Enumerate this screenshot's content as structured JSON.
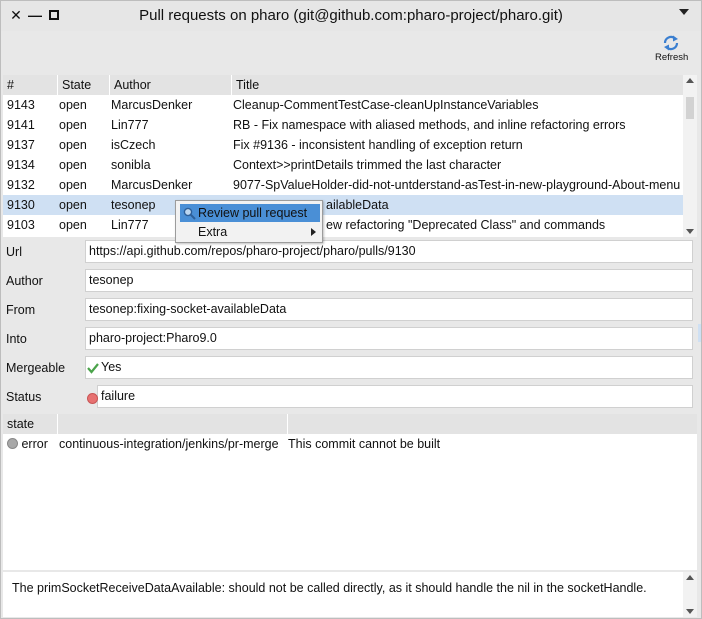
{
  "window": {
    "title": "Pull requests on pharo (git@github.com:pharo-project/pharo.git)"
  },
  "toolbar": {
    "refresh_label": "Refresh",
    "refresh_icon": "refresh-icon"
  },
  "pr_table": {
    "columns": [
      "#",
      "State",
      "Author",
      "Title"
    ],
    "rows": [
      {
        "num": "9143",
        "state": "open",
        "author": "MarcusDenker",
        "title": "Cleanup-CommentTestCase-cleanUpInstanceVariables"
      },
      {
        "num": "9141",
        "state": "open",
        "author": "Lin777",
        "title": "RB - Fix namespace with aliased methods, and inline refactoring errors"
      },
      {
        "num": "9137",
        "state": "open",
        "author": "isCzech",
        "title": "Fix #9136 - inconsistent handling of exception return"
      },
      {
        "num": "9134",
        "state": "open",
        "author": "sonibla",
        "title": "Context>>printDetails trimmed the last character"
      },
      {
        "num": "9132",
        "state": "open",
        "author": "MarcusDenker",
        "title": "9077-SpValueHolder-did-not-untderstand-asTest-in-new-playground-About-menu"
      },
      {
        "num": "9130",
        "state": "open",
        "author": "tesonep",
        "title": "ailableData"
      },
      {
        "num": "9103",
        "state": "open",
        "author": "Lin777",
        "title": "ew refactoring \"Deprecated Class\" and commands"
      }
    ],
    "selected_index": 5
  },
  "context_menu": {
    "items": [
      {
        "label": "Review pull request",
        "icon": "magnifier-icon"
      },
      {
        "label": "Extra",
        "submenu": true
      }
    ]
  },
  "details": {
    "url_label": "Url",
    "url_value": "https://api.github.com/repos/pharo-project/pharo/pulls/9130",
    "author_label": "Author",
    "author_value": "tesonep",
    "from_label": "From",
    "from_value": "tesonep:fixing-socket-availableData",
    "into_label": "Into",
    "into_value": "pharo-project:Pharo9.0",
    "mergeable_label": "Mergeable",
    "mergeable_value": "Yes",
    "status_label": "Status",
    "status_value": "failure"
  },
  "state_table": {
    "columns": [
      "state",
      "",
      ""
    ],
    "rows": [
      {
        "state": "error",
        "context": "continuous-integration/jenkins/pr-merge",
        "description": "This commit cannot be built"
      }
    ]
  },
  "description": {
    "text": "The primSocketReceiveDataAvailable: should not be called directly, as it should handle the nil in the socketHandle."
  },
  "colors": {
    "selection": "#cfe0f3",
    "menu_highlight": "#4a8fd6",
    "refresh_blue": "#3b7fd0",
    "failure_red": "#e77171",
    "check_green": "#4aa34a"
  }
}
